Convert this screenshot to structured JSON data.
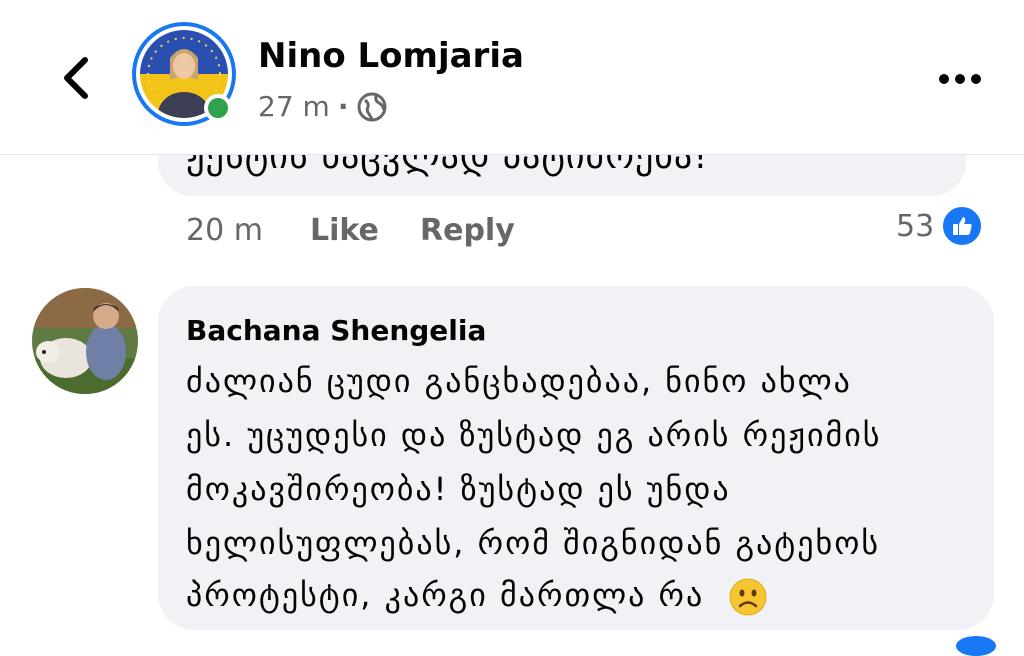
{
  "header": {
    "back_icon": "chevron-left-icon",
    "author_name": "Nino Lomjaria",
    "time": "27 m",
    "separator": "·",
    "audience_icon": "globe-icon",
    "more_icon": "more-horizontal-icon",
    "online": true
  },
  "previous_comment": {
    "partial_text": "ჟესტის ნაცვლად პატიმრება!",
    "time": "20 m",
    "like_label": "Like",
    "reply_label": "Reply",
    "reaction_count": "53",
    "reaction_icon": "thumbs-up-icon"
  },
  "comment": {
    "author": "Bachana Shengelia",
    "lines": [
      "ძალიან ცუდი განცხადებაა, ნინო ახლა",
      "ეს. უცუდესი და ზუსტად ეგ არის რეჟიმის",
      "მოკავშირეობა! ზუსტად ეს უნდა",
      "ხელისუფლებას, რომ შიგნიდან გატეხოს",
      "პროტესტი, კარგი მართლა რა"
    ],
    "emoji": "frowning-face-icon"
  },
  "colors": {
    "accent": "#1877f2",
    "bubble": "#f0f2f5",
    "secondary_text": "#65676b",
    "online": "#31a24c"
  }
}
